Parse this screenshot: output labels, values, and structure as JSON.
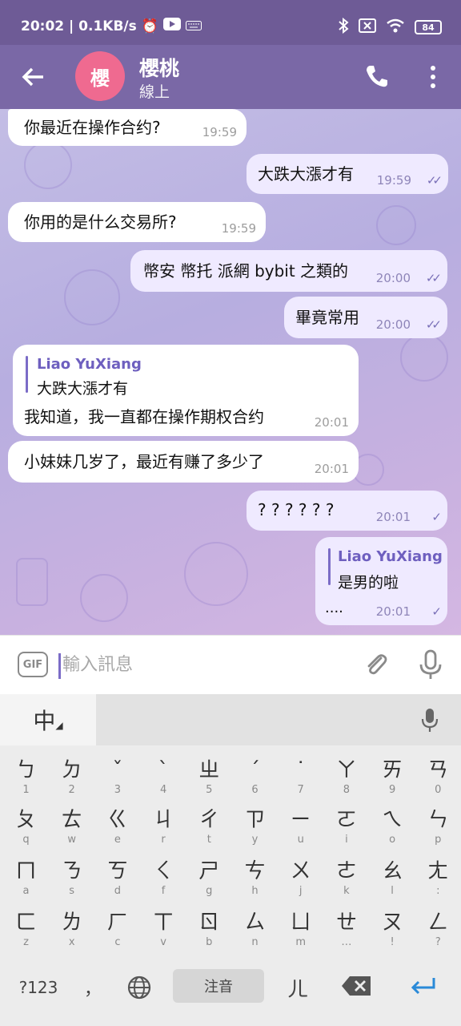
{
  "status_bar": {
    "time_speed": "20:02 | 0.1KB/s",
    "battery": "84",
    "icons": [
      "alarm-icon",
      "youtube-icon",
      "keyboard-icon",
      "bluetooth-icon",
      "sim-icon",
      "wifi-icon",
      "battery-icon"
    ]
  },
  "header": {
    "avatar_text": "櫻",
    "avatar_color": "#ef6a90",
    "title": "櫻桃",
    "status": "線上"
  },
  "messages": [
    {
      "dir": "in",
      "text": "你最近在操作合约?",
      "time": "19:59"
    },
    {
      "dir": "out",
      "text": "大跌大漲才有",
      "time": "19:59",
      "checks": "✓✓"
    },
    {
      "dir": "in",
      "text": "你用的是什么交易所?",
      "time": "19:59"
    },
    {
      "dir": "out",
      "text": "幣安 幣托 派網 bybit 之類的",
      "time": "20:00",
      "checks": "✓✓"
    },
    {
      "dir": "out",
      "text": "畢竟常用",
      "time": "20:00",
      "checks": "✓✓"
    },
    {
      "dir": "in",
      "reply_name": "Liao YuXiang",
      "reply_text": "大跌大漲才有",
      "text": "我知道，我一直都在操作期权合约",
      "time": "20:01"
    },
    {
      "dir": "in",
      "text": "小妹妹几岁了，最近有赚了多少了",
      "time": "20:01"
    },
    {
      "dir": "out",
      "text": "? ? ? ? ? ?",
      "time": "20:01",
      "checks": "✓"
    },
    {
      "dir": "out",
      "reply_name": "Liao YuXiang",
      "reply_text": "是男的啦",
      "text": "....",
      "time": "20:01",
      "checks": "✓"
    }
  ],
  "input": {
    "gif_label": "GIF",
    "placeholder": "輸入訊息"
  },
  "keyboard": {
    "lang_label": "中",
    "rows": [
      [
        {
          "m": "ㄅ",
          "s": "1"
        },
        {
          "m": "ㄉ",
          "s": "2"
        },
        {
          "m": "ˇ",
          "s": "3"
        },
        {
          "m": "ˋ",
          "s": "4"
        },
        {
          "m": "ㄓ",
          "s": "5"
        },
        {
          "m": "ˊ",
          "s": "6"
        },
        {
          "m": "˙",
          "s": "7"
        },
        {
          "m": "ㄚ",
          "s": "8"
        },
        {
          "m": "ㄞ",
          "s": "9"
        },
        {
          "m": "ㄢ",
          "s": "0"
        }
      ],
      [
        {
          "m": "ㄆ",
          "s": "q"
        },
        {
          "m": "ㄊ",
          "s": "w"
        },
        {
          "m": "ㄍ",
          "s": "e"
        },
        {
          "m": "ㄐ",
          "s": "r"
        },
        {
          "m": "ㄔ",
          "s": "t"
        },
        {
          "m": "ㄗ",
          "s": "y"
        },
        {
          "m": "ㄧ",
          "s": "u"
        },
        {
          "m": "ㄛ",
          "s": "i"
        },
        {
          "m": "ㄟ",
          "s": "o"
        },
        {
          "m": "ㄣ",
          "s": "p"
        }
      ],
      [
        {
          "m": "ㄇ",
          "s": "a"
        },
        {
          "m": "ㄋ",
          "s": "s"
        },
        {
          "m": "ㄎ",
          "s": "d"
        },
        {
          "m": "ㄑ",
          "s": "f"
        },
        {
          "m": "ㄕ",
          "s": "g"
        },
        {
          "m": "ㄘ",
          "s": "h"
        },
        {
          "m": "ㄨ",
          "s": "j"
        },
        {
          "m": "ㄜ",
          "s": "k"
        },
        {
          "m": "ㄠ",
          "s": "l"
        },
        {
          "m": "ㄤ",
          "s": ":"
        }
      ],
      [
        {
          "m": "ㄈ",
          "s": "z"
        },
        {
          "m": "ㄌ",
          "s": "x"
        },
        {
          "m": "ㄏ",
          "s": "c"
        },
        {
          "m": "ㄒ",
          "s": "v"
        },
        {
          "m": "ㄖ",
          "s": "b"
        },
        {
          "m": "ㄙ",
          "s": "n"
        },
        {
          "m": "ㄩ",
          "s": "m"
        },
        {
          "m": "ㄝ",
          "s": "…"
        },
        {
          "m": "ㄡ",
          "s": "!"
        },
        {
          "m": "ㄥ",
          "s": "?"
        }
      ]
    ],
    "num_label": "?123",
    "punct_label": "，",
    "space_label": "注音",
    "er_label": "ㄦ"
  }
}
